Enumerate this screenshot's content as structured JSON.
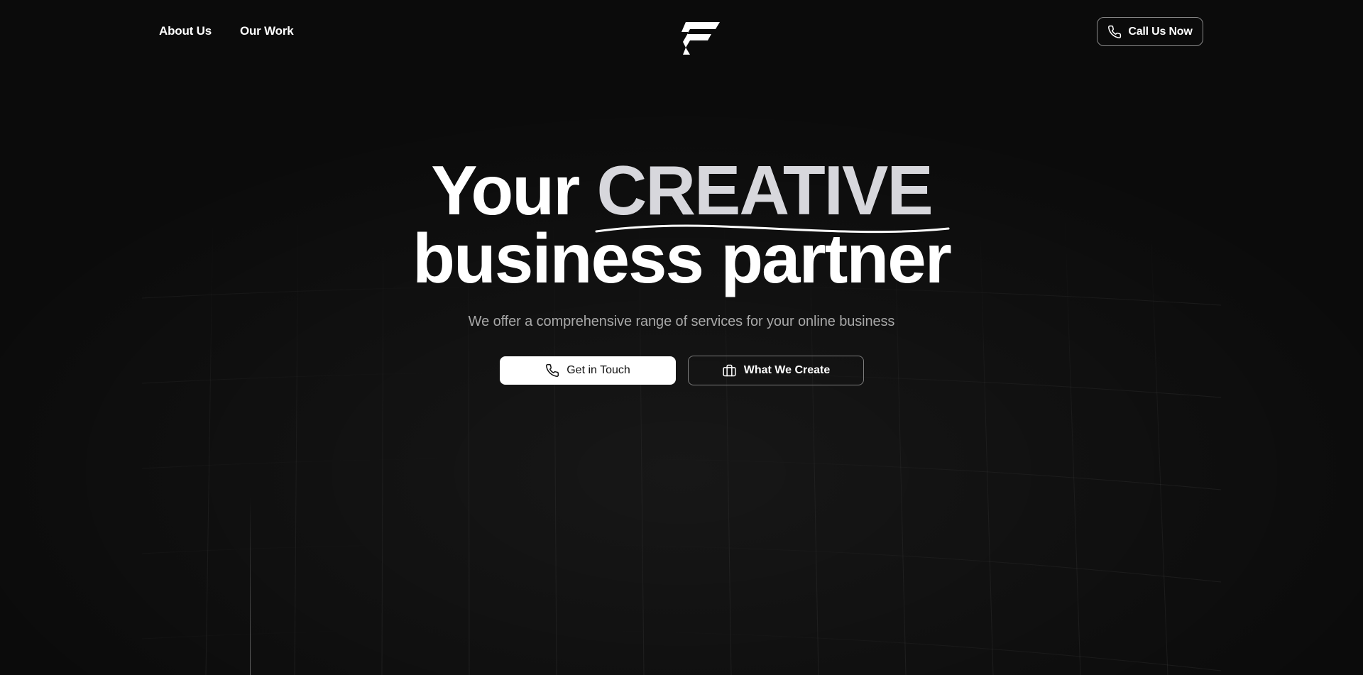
{
  "nav": {
    "links": [
      {
        "label": "About Us"
      },
      {
        "label": "Our Work"
      }
    ],
    "logo_icon": "brand-f-logo-icon",
    "cta": {
      "label": "Call Us Now",
      "icon": "phone-icon"
    }
  },
  "hero": {
    "headline_part1": "Your",
    "headline_highlight": "CREATIVE",
    "headline_line2": "business partner",
    "subtitle": "We offer a comprehensive range of services for your online business",
    "primary_button": {
      "label": "Get in Touch",
      "icon": "phone-icon"
    },
    "secondary_button": {
      "label": "What We Create",
      "icon": "briefcase-icon"
    }
  },
  "colors": {
    "background": "#0b0b0b",
    "text": "#ffffff",
    "highlight": "#d7d7dc",
    "subtitle": "#a8a8a8",
    "border": "#8a8a8a"
  }
}
